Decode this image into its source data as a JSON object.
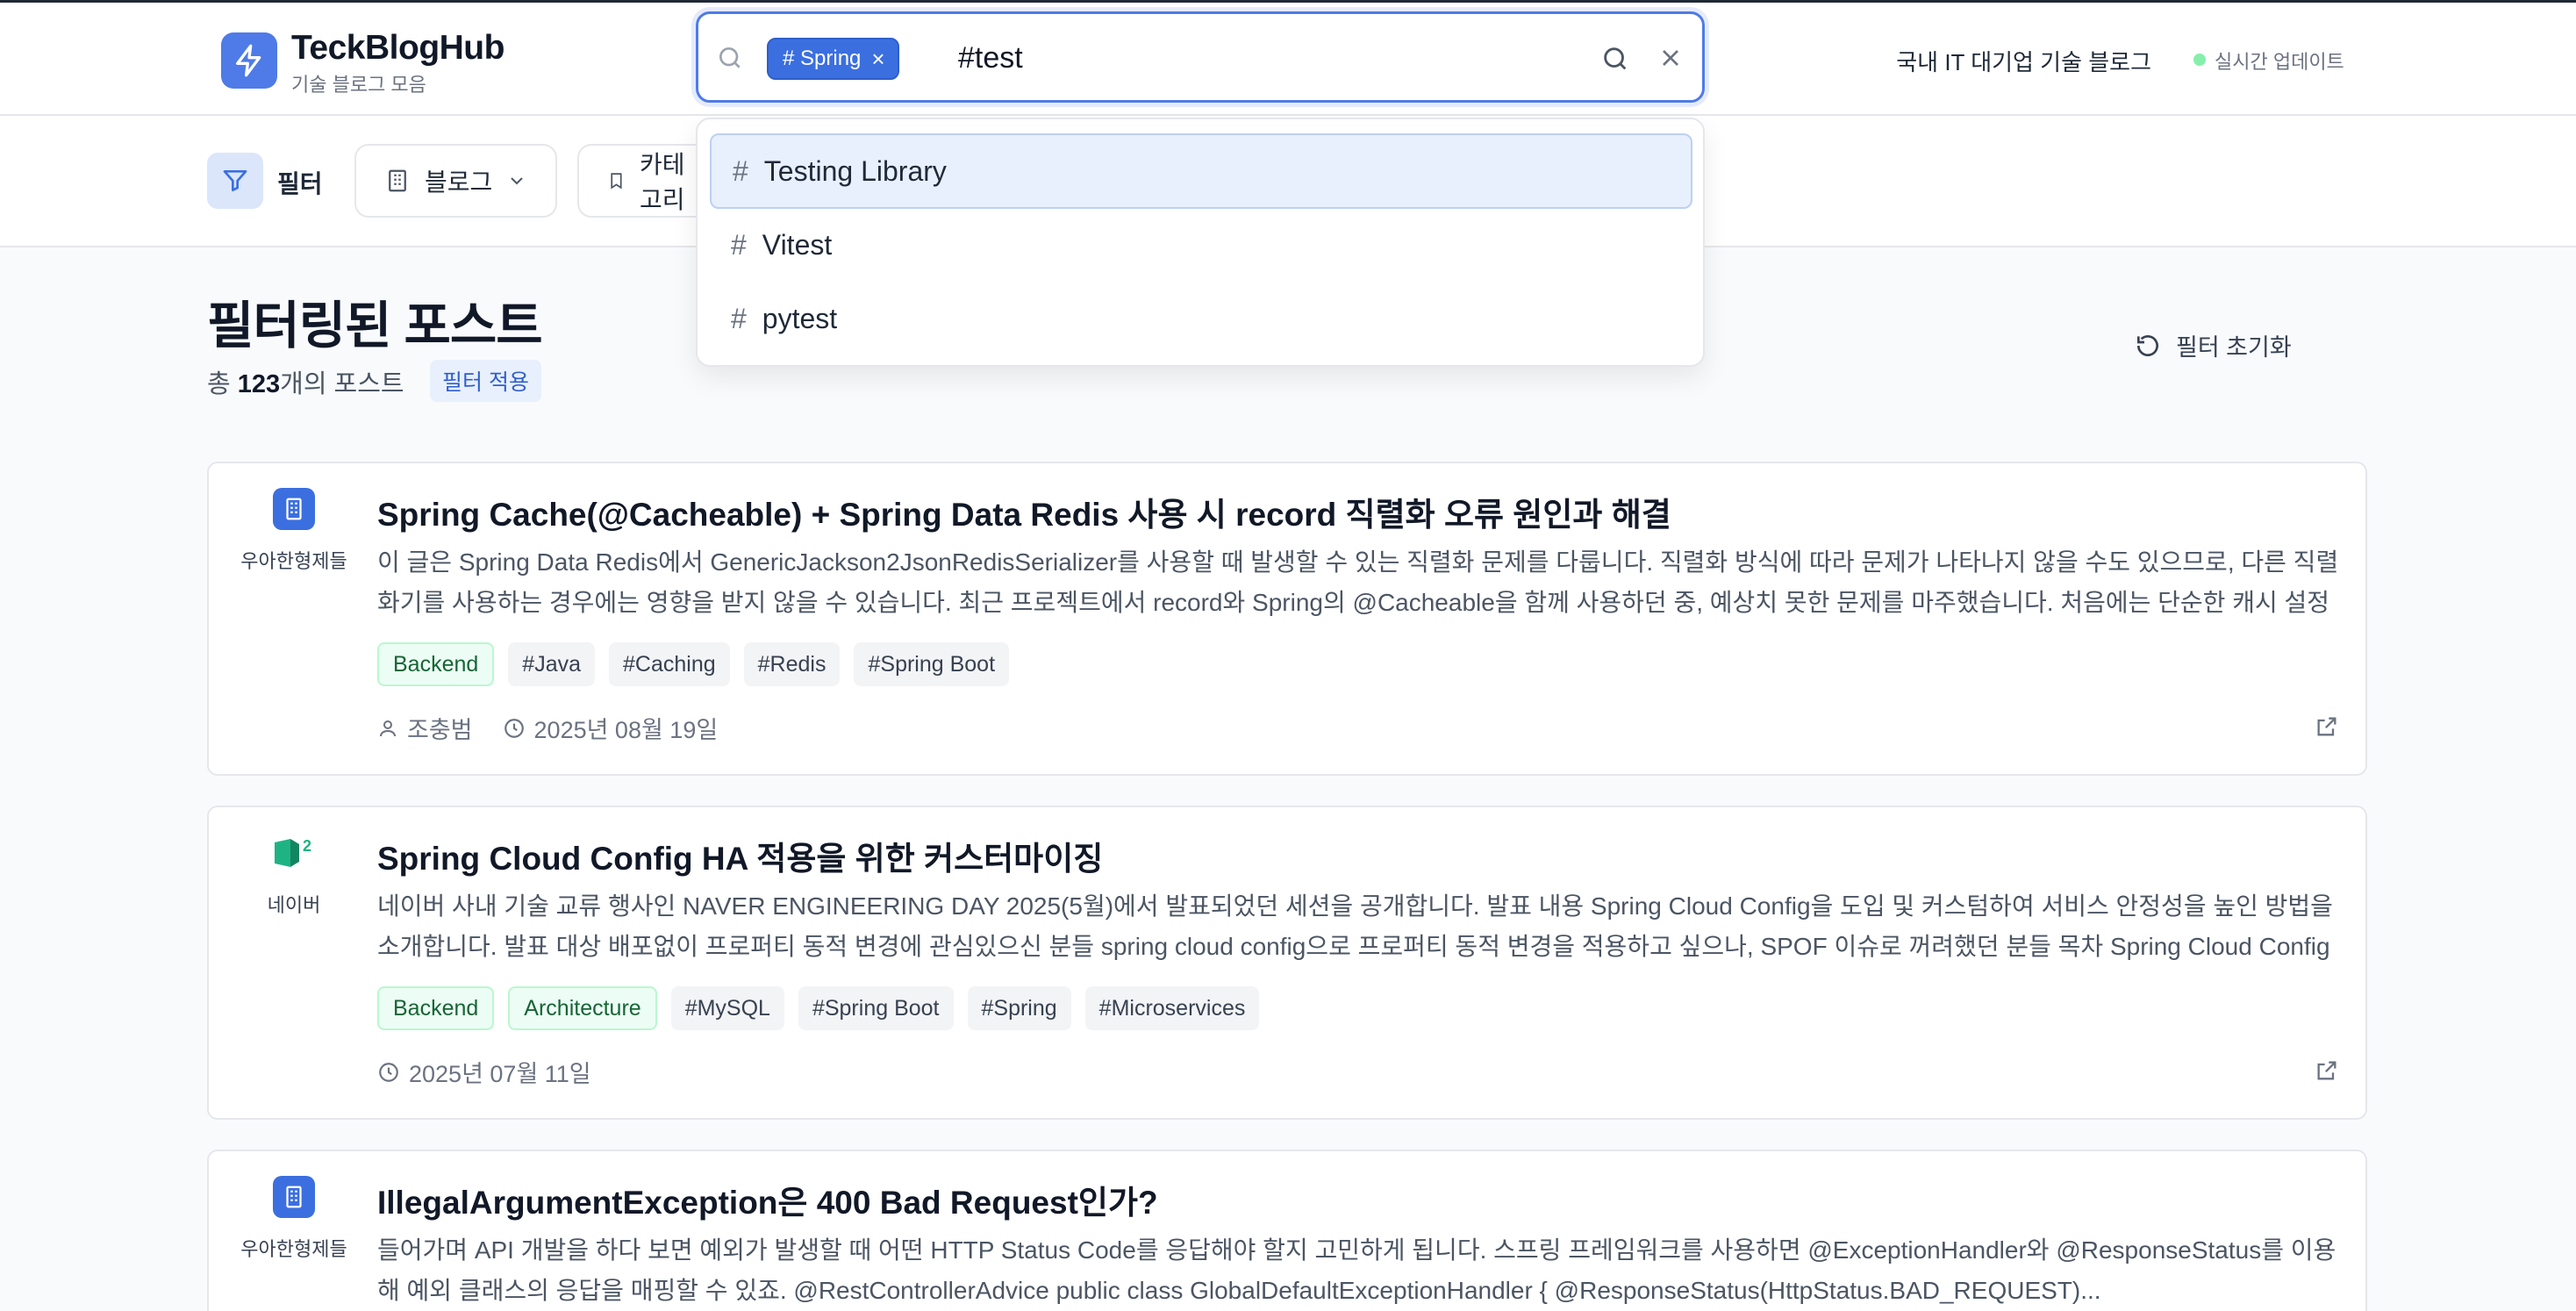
{
  "header": {
    "app_title": "TeckBlogHub",
    "app_subtitle": "기술 블로그 모음",
    "right_title": "국내 IT 대기업 기술 블로그",
    "live_status": "실시간 업데이트"
  },
  "search": {
    "chip_label": "# Spring",
    "chip_remove": "×",
    "query": "#test",
    "suggestions": [
      {
        "hash": "#",
        "label": "Testing Library"
      },
      {
        "hash": "#",
        "label": "Vitest"
      },
      {
        "hash": "#",
        "label": "pytest"
      }
    ]
  },
  "filterbar": {
    "filter_label": "필터",
    "blog_label": "블로그",
    "category_label": "카테고리"
  },
  "main": {
    "title": "필터링된 포스트",
    "count_prefix": "총 ",
    "count": "123",
    "count_suffix": "개의 포스트",
    "filter_applied": "필터 적용",
    "reset_label": "필터 초기화"
  },
  "posts": [
    {
      "source": "우아한형제들",
      "title": "Spring Cache(@Cacheable) + Spring Data Redis 사용 시 record 직렬화 오류 원인과 해결",
      "desc": "이 글은 Spring Data Redis에서 GenericJackson2JsonRedisSerializer를 사용할 때 발생할 수 있는 직렬화 문제를 다룹니다. 직렬화 방식에 따라 문제가 나타나지 않을 수도 있으므로, 다른 직렬화기를 사용하는 경우에는 영향을 받지 않을 수 있습니다. 최근 프로젝트에서 record와 Spring의 @Cacheable을 함께 사용하던 중, 예상치 못한 문제를 마주했습니다. 처음에는 단순한 캐시 설정 이슈로 ...",
      "tags": [
        {
          "label": "Backend",
          "kind": "cat"
        },
        {
          "label": "#Java",
          "kind": "hash"
        },
        {
          "label": "#Caching",
          "kind": "hash"
        },
        {
          "label": "#Redis",
          "kind": "hash"
        },
        {
          "label": "#Spring Boot",
          "kind": "hash"
        }
      ],
      "author": "조충범",
      "date": "2025년 08월 19일"
    },
    {
      "source": "네이버",
      "title": "Spring Cloud Config HA 적용을 위한 커스터마이징",
      "desc": "네이버 사내 기술 교류 행사인 NAVER ENGINEERING DAY 2025(5월)에서 발표되었던 세션을 공개합니다. 발표 내용 Spring Cloud Config을 도입 및 커스텀하여 서비스 안정성을 높인 방법을 소개합니다. 발표 대상 배포없이 프로퍼티 동적 변경에 관심있으신 분들 spring cloud config으로 프로퍼티 동적 변경을 적용하고 싶으나, SPOF 이슈로 꺼려했던 분들 목차 Spring Cloud Config 소개...",
      "tags": [
        {
          "label": "Backend",
          "kind": "cat"
        },
        {
          "label": "Architecture",
          "kind": "cat"
        },
        {
          "label": "#MySQL",
          "kind": "hash"
        },
        {
          "label": "#Spring Boot",
          "kind": "hash"
        },
        {
          "label": "#Spring",
          "kind": "hash"
        },
        {
          "label": "#Microservices",
          "kind": "hash"
        }
      ],
      "author": "",
      "date": "2025년 07월 11일"
    },
    {
      "source": "우아한형제들",
      "title": "IllegalArgumentException은 400 Bad Request인가?",
      "desc": "들어가며 API 개발을 하다 보면 예외가 발생할 때 어떤 HTTP Status Code를 응답해야 할지 고민하게 됩니다. 스프링 프레임워크를 사용하면 @ExceptionHandler와 @ResponseStatus를 이용해 예외 클래스의 응답을 매핑할 수 있죠. @RestControllerAdvice public class GlobalDefaultExceptionHandler { @ResponseStatus(HttpStatus.BAD_REQUEST)...",
      "tags": [],
      "author": "",
      "date": ""
    }
  ],
  "colors": {
    "accent": "#4f7be8",
    "chip": "#3b6fe0",
    "category_tag_bg": "#ecfdf5",
    "hash_tag_bg": "#f3f4f6",
    "live_dot": "#86efac"
  }
}
